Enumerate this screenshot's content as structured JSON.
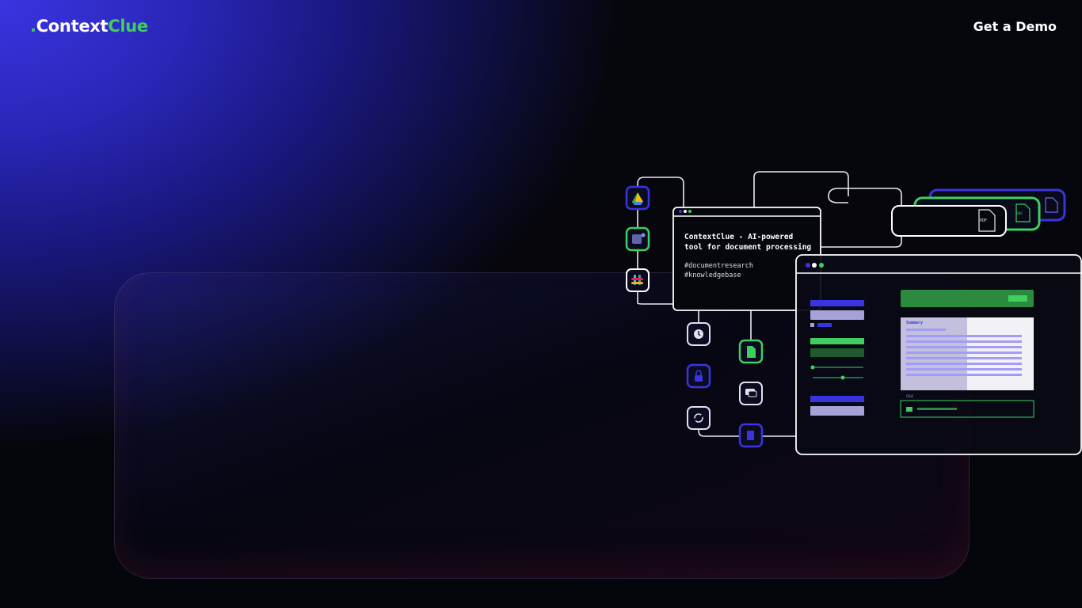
{
  "header": {
    "logo": {
      "dot": ".",
      "context": "Context",
      "clue": "Clue"
    },
    "cta_label": "Get a Demo"
  },
  "card": {
    "title": "ContextClue - AI-powered tool for document processing",
    "title_line1": "ContextClue - AI-powered",
    "title_line2": "tool for document processing",
    "tag1": "#documentresearch",
    "tag2": "#knowledgebase"
  },
  "panel": {
    "summary_label": "Summary",
    "qa_label": "Q&A"
  },
  "files": {
    "pdf": "PDF",
    "doc": "DOC"
  },
  "integrations": [
    "google-drive-icon",
    "teams-icon",
    "slack-icon"
  ],
  "features": [
    "clock-icon",
    "lock-icon",
    "sync-icon",
    "document-icon",
    "chat-icon",
    "sheet-icon"
  ],
  "colors": {
    "brand_green": "#3ecf5e",
    "brand_blue": "#3a34e0",
    "background": "#05060c"
  }
}
